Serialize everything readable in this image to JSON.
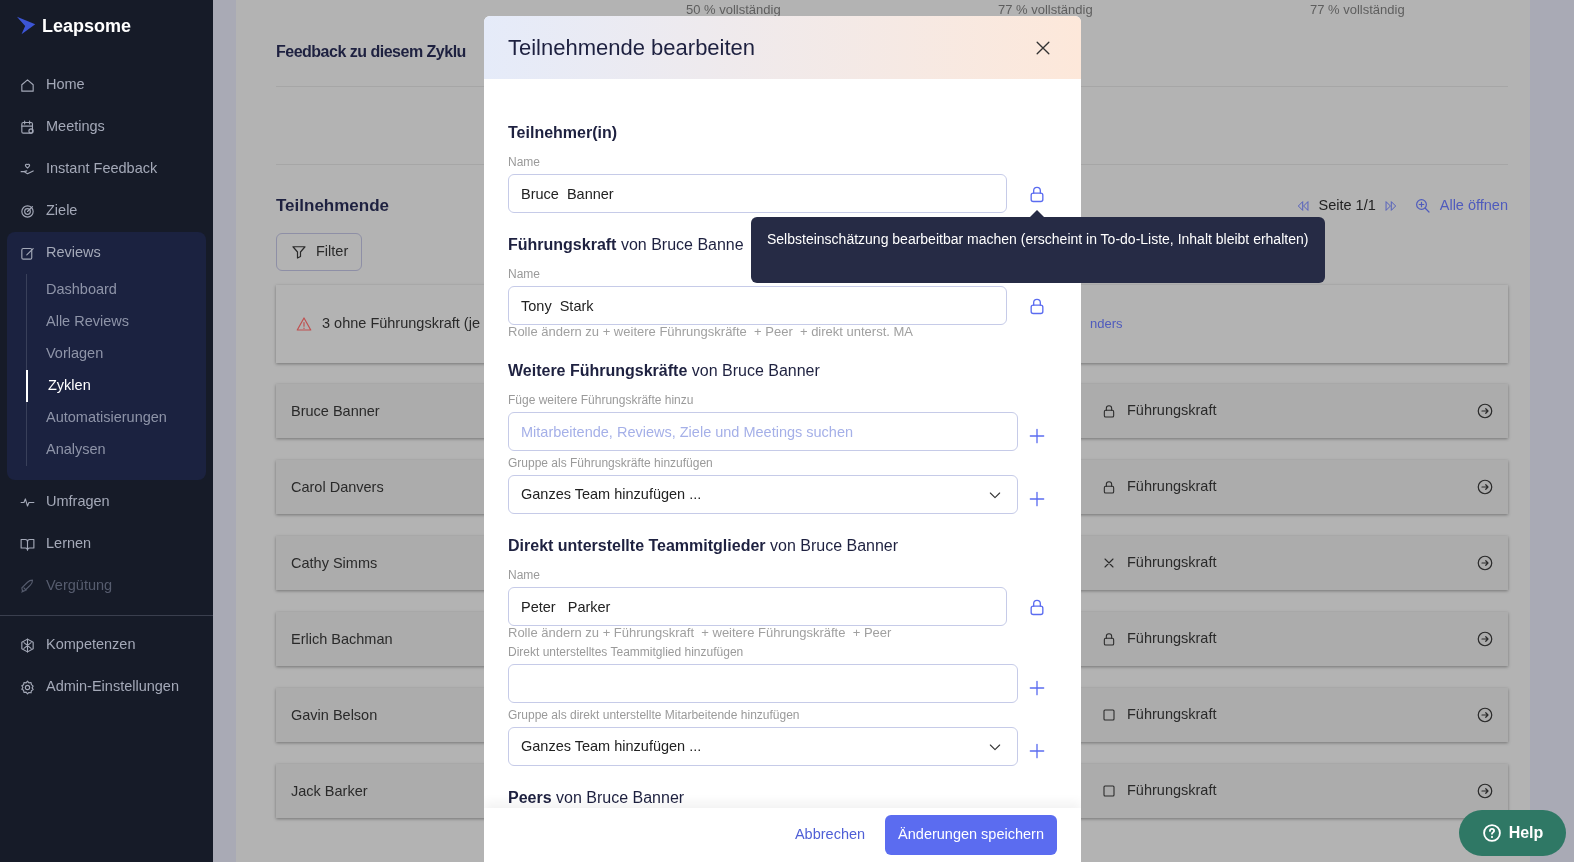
{
  "sidebar": {
    "logo": "Leapsome",
    "items": [
      {
        "label": "Home",
        "disabled": false
      },
      {
        "label": "Meetings",
        "disabled": false
      },
      {
        "label": "Instant Feedback",
        "disabled": false
      },
      {
        "label": "Ziele",
        "disabled": false
      },
      {
        "label": "Reviews",
        "disabled": false,
        "expanded": true,
        "children": [
          {
            "label": "Dashboard",
            "selected": false
          },
          {
            "label": "Alle Reviews",
            "selected": false
          },
          {
            "label": "Vorlagen",
            "selected": false
          },
          {
            "label": "Zyklen",
            "selected": true
          },
          {
            "label": "Automatisierungen",
            "selected": false
          },
          {
            "label": "Analysen",
            "selected": false
          }
        ]
      },
      {
        "label": "Umfragen",
        "disabled": false
      },
      {
        "label": "Lernen",
        "disabled": false
      },
      {
        "label": "Vergütung",
        "disabled": true
      }
    ],
    "bottom_items": [
      {
        "label": "Kompetenzen",
        "disabled": false
      },
      {
        "label": "Admin-Einstellungen",
        "disabled": false
      }
    ]
  },
  "page": {
    "progress": [
      "50 % vollständig",
      "77 % vollständig",
      "77 % vollständig"
    ],
    "feedback_title": "Feedback zu diesem Zyklu",
    "participants_title": "Teilnehmende",
    "pager": "Seite 1/1",
    "open_all": "Alle öffnen",
    "filter": "Filter",
    "warning": {
      "text": "3 ohne Führungskraft (je",
      "link": "nders"
    },
    "rows": [
      {
        "name": "Bruce Banner",
        "kind": "locked",
        "role": "Führungskraft"
      },
      {
        "name": "Carol Danvers",
        "kind": "locked",
        "role": "Führungskraft"
      },
      {
        "name": "Cathy Simms",
        "kind": "removed",
        "role": "Führungskraft"
      },
      {
        "name": "Erlich Bachman",
        "kind": "locked",
        "role": "Führungskraft"
      },
      {
        "name": "Gavin Belson",
        "kind": "open",
        "role": "Führungskraft"
      },
      {
        "name": "Jack Barker",
        "kind": "open",
        "role": "Führungskraft"
      }
    ]
  },
  "modal": {
    "title": "Teilnehmende bearbeiten",
    "sections": [
      {
        "kind": "participant",
        "heading": "Teilnehmer(in)",
        "fields": [
          {
            "kind": "input",
            "label": "Name",
            "value": "Bruce  Banner",
            "locked": true
          }
        ]
      },
      {
        "kind": "relation",
        "heading": "**Führungskraft** von Bruce Banne",
        "fields": [
          {
            "kind": "input",
            "label": "Name",
            "value": "Tony  Stark",
            "locked": true,
            "note": "Rolle ändern zu + weitere Führungskräfte  + Peer  + direkt unterst. MA"
          }
        ]
      },
      {
        "kind": "relation",
        "heading": "**Weitere Führungskräfte** von Bruce Banner",
        "fields": [
          {
            "kind": "input",
            "label": "Füge weitere Führungskräfte hinzu",
            "placeholder": "Mitarbeitende, Reviews, Ziele und Meetings suchen",
            "add_button": true
          },
          {
            "kind": "select",
            "label": "Gruppe als Führungskräfte hinzufügen",
            "value": "Ganzes Team hinzufügen ...",
            "add_button": true
          }
        ]
      },
      {
        "kind": "relation",
        "heading": "**Direkt unterstellte Teammitglieder** von Bruce Banner",
        "fields": [
          {
            "kind": "input",
            "label": "Name",
            "value": "Peter   Parker",
            "locked": true,
            "note": "Rolle ändern zu + Führungskraft  + weitere Führungskräfte  + Peer"
          },
          {
            "kind": "input",
            "label": "Direkt unterstelltes Teammitglied hinzufügen",
            "add_button": true
          },
          {
            "kind": "select",
            "label": "Gruppe als direkt unterstellte Mitarbeitende hinzufügen",
            "value": "Ganzes Team hinzufügen ...",
            "add_button": true
          }
        ]
      },
      {
        "kind": "relation",
        "heading": "**Peers** von Bruce Banner"
      }
    ],
    "tooltip": "Selbsteinschätzung bearbeitbar machen (erscheint in To-do-Liste, Inhalt bleibt erhalten)",
    "cancel": "Abbrechen",
    "save": "Änderungen speichern"
  },
  "help": "Help"
}
